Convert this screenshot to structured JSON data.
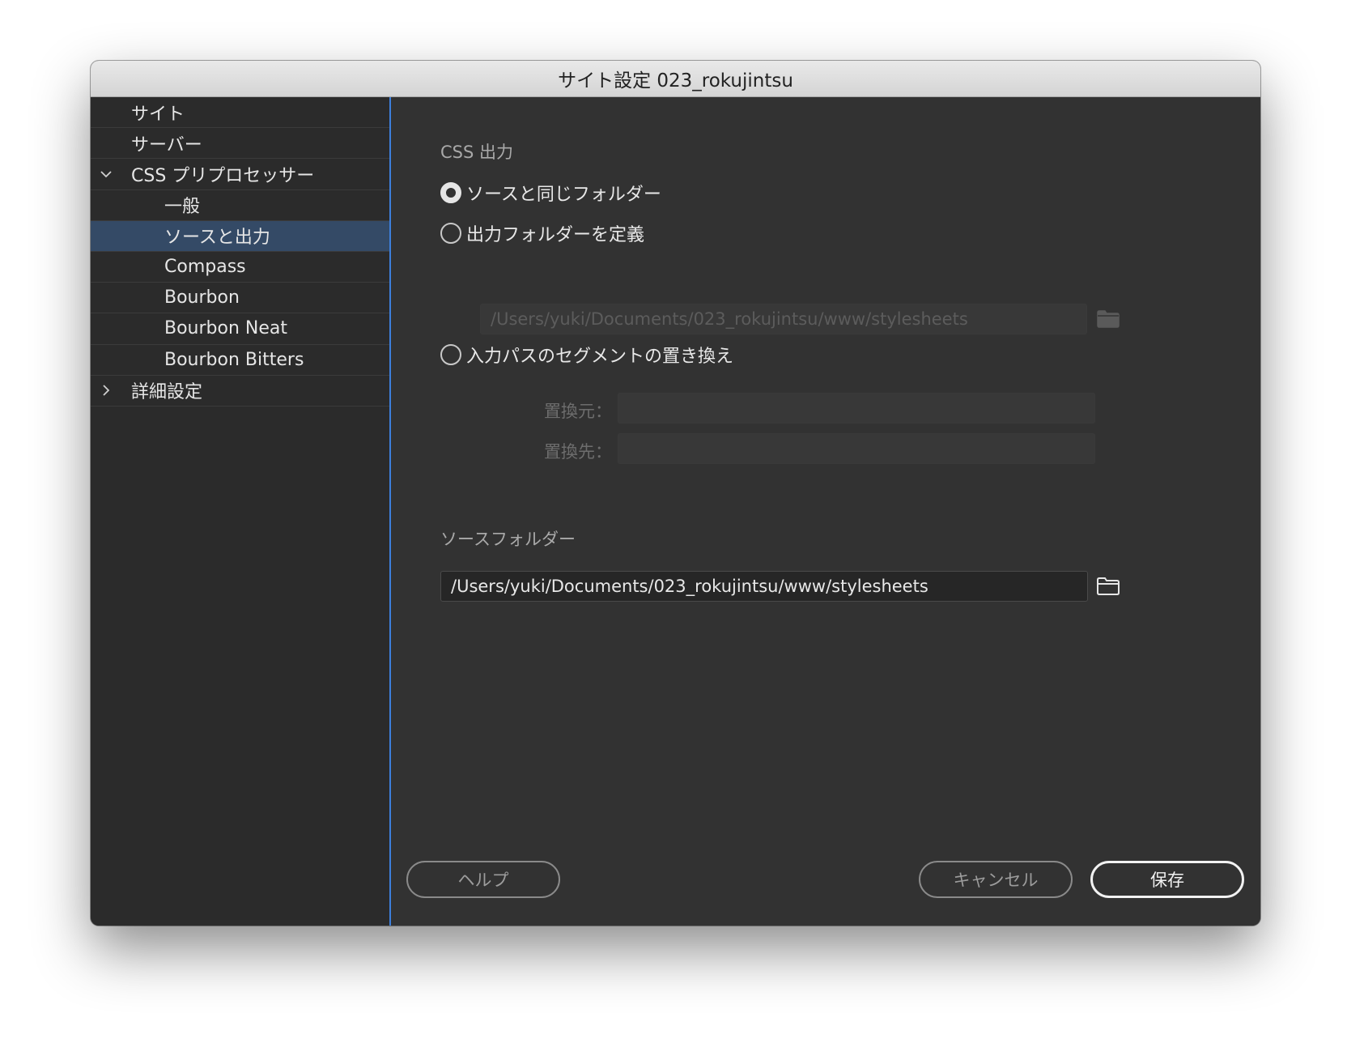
{
  "window": {
    "title": "サイト設定 023_rokujintsu"
  },
  "sidebar": {
    "items": [
      {
        "label": "サイト",
        "level": 0,
        "chevron": ""
      },
      {
        "label": "サーバー",
        "level": 0,
        "chevron": ""
      },
      {
        "label": "CSS プリプロセッサー",
        "level": 0,
        "chevron": "chevron-down"
      },
      {
        "label": "一般",
        "level": 1,
        "chevron": ""
      },
      {
        "label": "ソースと出力",
        "level": 1,
        "chevron": "",
        "selected": true
      },
      {
        "label": "Compass",
        "level": 1,
        "chevron": ""
      },
      {
        "label": "Bourbon",
        "level": 1,
        "chevron": ""
      },
      {
        "label": "Bourbon Neat",
        "level": 1,
        "chevron": ""
      },
      {
        "label": "Bourbon Bitters",
        "level": 1,
        "chevron": ""
      },
      {
        "label": "詳細設定",
        "level": 0,
        "chevron": "chevron-right"
      }
    ]
  },
  "css_output": {
    "heading": "CSS 出力",
    "options": [
      {
        "label": "ソースと同じフォルダー",
        "checked": true
      },
      {
        "label": "出力フォルダーを定義",
        "checked": false
      },
      {
        "label": "入力パスのセグメントの置き換え",
        "checked": false
      }
    ],
    "output_folder_path": "/Users/yuki/Documents/023_rokujintsu/www/stylesheets",
    "replace_from_label": "置換元：",
    "replace_to_label": "置換先：",
    "replace_from_value": "",
    "replace_to_value": ""
  },
  "source_folder": {
    "heading": "ソースフォルダー",
    "path": "/Users/yuki/Documents/023_rokujintsu/www/stylesheets"
  },
  "buttons": {
    "help": "ヘルプ",
    "cancel": "キャンセル",
    "save": "保存"
  },
  "colors": {
    "accent": "#3d7fdc",
    "selection": "#344a66",
    "sidebar_bg": "#2b2b2b",
    "panel_bg": "#323232"
  },
  "icons": {
    "folder": "folder-icon"
  }
}
